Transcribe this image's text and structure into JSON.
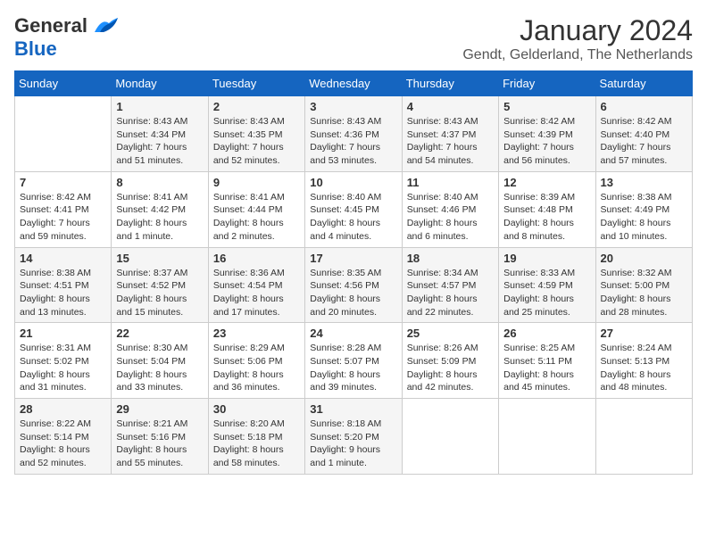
{
  "header": {
    "logo": {
      "line1": "General",
      "line2": "Blue"
    },
    "title": "January 2024",
    "subtitle": "Gendt, Gelderland, The Netherlands"
  },
  "weekdays": [
    "Sunday",
    "Monday",
    "Tuesday",
    "Wednesday",
    "Thursday",
    "Friday",
    "Saturday"
  ],
  "weeks": [
    [
      {
        "day": "",
        "content": ""
      },
      {
        "day": "1",
        "content": "Sunrise: 8:43 AM\nSunset: 4:34 PM\nDaylight: 7 hours\nand 51 minutes."
      },
      {
        "day": "2",
        "content": "Sunrise: 8:43 AM\nSunset: 4:35 PM\nDaylight: 7 hours\nand 52 minutes."
      },
      {
        "day": "3",
        "content": "Sunrise: 8:43 AM\nSunset: 4:36 PM\nDaylight: 7 hours\nand 53 minutes."
      },
      {
        "day": "4",
        "content": "Sunrise: 8:43 AM\nSunset: 4:37 PM\nDaylight: 7 hours\nand 54 minutes."
      },
      {
        "day": "5",
        "content": "Sunrise: 8:42 AM\nSunset: 4:39 PM\nDaylight: 7 hours\nand 56 minutes."
      },
      {
        "day": "6",
        "content": "Sunrise: 8:42 AM\nSunset: 4:40 PM\nDaylight: 7 hours\nand 57 minutes."
      }
    ],
    [
      {
        "day": "7",
        "content": "Sunrise: 8:42 AM\nSunset: 4:41 PM\nDaylight: 7 hours\nand 59 minutes."
      },
      {
        "day": "8",
        "content": "Sunrise: 8:41 AM\nSunset: 4:42 PM\nDaylight: 8 hours\nand 1 minute."
      },
      {
        "day": "9",
        "content": "Sunrise: 8:41 AM\nSunset: 4:44 PM\nDaylight: 8 hours\nand 2 minutes."
      },
      {
        "day": "10",
        "content": "Sunrise: 8:40 AM\nSunset: 4:45 PM\nDaylight: 8 hours\nand 4 minutes."
      },
      {
        "day": "11",
        "content": "Sunrise: 8:40 AM\nSunset: 4:46 PM\nDaylight: 8 hours\nand 6 minutes."
      },
      {
        "day": "12",
        "content": "Sunrise: 8:39 AM\nSunset: 4:48 PM\nDaylight: 8 hours\nand 8 minutes."
      },
      {
        "day": "13",
        "content": "Sunrise: 8:38 AM\nSunset: 4:49 PM\nDaylight: 8 hours\nand 10 minutes."
      }
    ],
    [
      {
        "day": "14",
        "content": "Sunrise: 8:38 AM\nSunset: 4:51 PM\nDaylight: 8 hours\nand 13 minutes."
      },
      {
        "day": "15",
        "content": "Sunrise: 8:37 AM\nSunset: 4:52 PM\nDaylight: 8 hours\nand 15 minutes."
      },
      {
        "day": "16",
        "content": "Sunrise: 8:36 AM\nSunset: 4:54 PM\nDaylight: 8 hours\nand 17 minutes."
      },
      {
        "day": "17",
        "content": "Sunrise: 8:35 AM\nSunset: 4:56 PM\nDaylight: 8 hours\nand 20 minutes."
      },
      {
        "day": "18",
        "content": "Sunrise: 8:34 AM\nSunset: 4:57 PM\nDaylight: 8 hours\nand 22 minutes."
      },
      {
        "day": "19",
        "content": "Sunrise: 8:33 AM\nSunset: 4:59 PM\nDaylight: 8 hours\nand 25 minutes."
      },
      {
        "day": "20",
        "content": "Sunrise: 8:32 AM\nSunset: 5:00 PM\nDaylight: 8 hours\nand 28 minutes."
      }
    ],
    [
      {
        "day": "21",
        "content": "Sunrise: 8:31 AM\nSunset: 5:02 PM\nDaylight: 8 hours\nand 31 minutes."
      },
      {
        "day": "22",
        "content": "Sunrise: 8:30 AM\nSunset: 5:04 PM\nDaylight: 8 hours\nand 33 minutes."
      },
      {
        "day": "23",
        "content": "Sunrise: 8:29 AM\nSunset: 5:06 PM\nDaylight: 8 hours\nand 36 minutes."
      },
      {
        "day": "24",
        "content": "Sunrise: 8:28 AM\nSunset: 5:07 PM\nDaylight: 8 hours\nand 39 minutes."
      },
      {
        "day": "25",
        "content": "Sunrise: 8:26 AM\nSunset: 5:09 PM\nDaylight: 8 hours\nand 42 minutes."
      },
      {
        "day": "26",
        "content": "Sunrise: 8:25 AM\nSunset: 5:11 PM\nDaylight: 8 hours\nand 45 minutes."
      },
      {
        "day": "27",
        "content": "Sunrise: 8:24 AM\nSunset: 5:13 PM\nDaylight: 8 hours\nand 48 minutes."
      }
    ],
    [
      {
        "day": "28",
        "content": "Sunrise: 8:22 AM\nSunset: 5:14 PM\nDaylight: 8 hours\nand 52 minutes."
      },
      {
        "day": "29",
        "content": "Sunrise: 8:21 AM\nSunset: 5:16 PM\nDaylight: 8 hours\nand 55 minutes."
      },
      {
        "day": "30",
        "content": "Sunrise: 8:20 AM\nSunset: 5:18 PM\nDaylight: 8 hours\nand 58 minutes."
      },
      {
        "day": "31",
        "content": "Sunrise: 8:18 AM\nSunset: 5:20 PM\nDaylight: 9 hours\nand 1 minute."
      },
      {
        "day": "",
        "content": ""
      },
      {
        "day": "",
        "content": ""
      },
      {
        "day": "",
        "content": ""
      }
    ]
  ]
}
